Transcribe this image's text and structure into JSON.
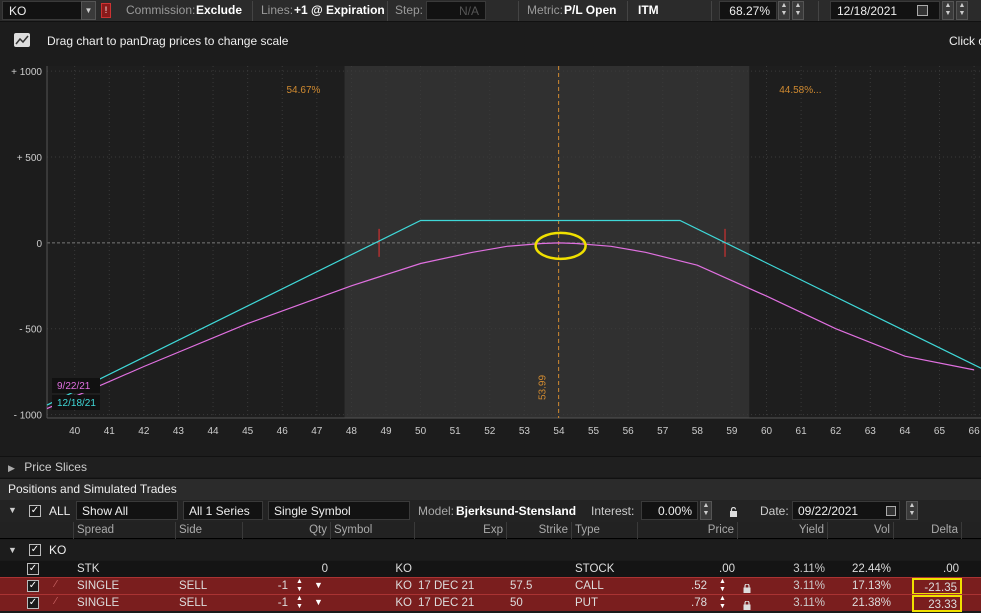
{
  "toolbar": {
    "symbol": "KO",
    "commission_label": "Commission:",
    "commission_value": "Exclude",
    "lines_label": "Lines:",
    "lines_value": "+1 @ Expiration",
    "step_label": "Step:",
    "step_value": "N/A",
    "metric_label": "Metric:",
    "metric_value": "P/L Open",
    "itm_label": "ITM",
    "itm_value": "68.27%",
    "date_value": "12/18/2021"
  },
  "hint": {
    "drag_text": "Drag chart to panDrag prices to change scale",
    "right_text": "Click o"
  },
  "chart_data": {
    "type": "line",
    "x_ticks": [
      40,
      41,
      42,
      43,
      44,
      45,
      46,
      47,
      48,
      49,
      50,
      51,
      52,
      53,
      54,
      55,
      56,
      57,
      58,
      59,
      60,
      61,
      62,
      63,
      64,
      65,
      66
    ],
    "x_tick_labels": [
      "40",
      "41",
      "42",
      "43",
      "44",
      "45",
      "46",
      "47",
      "48",
      "49",
      "50",
      "51",
      "52",
      "53",
      "54",
      "55",
      "56",
      "57",
      "58",
      "59",
      "60",
      "61",
      "62",
      "63",
      "64",
      "65",
      "66"
    ],
    "y_ticks": [
      1000,
      500,
      0,
      -500,
      -1000
    ],
    "y_tick_labels": [
      "+ 1000",
      "+ 500",
      "0",
      "- 500",
      "- 1000"
    ],
    "xlim": [
      39.2,
      66.2
    ],
    "ylim": [
      -1020,
      1030
    ],
    "itm_region": [
      47.8,
      59.5
    ],
    "pct_left": "54.67%",
    "pct_right": "44.58%...",
    "current_price": 53.99,
    "current_price_label": "53.99",
    "breakevens": [
      48.8,
      58.8
    ],
    "series": [
      {
        "name": "12/18/21",
        "color": "#3fd8d8",
        "x": [
          39.2,
          50.0,
          57.5,
          66.2
        ],
        "y": [
          -945,
          130,
          130,
          -730
        ]
      },
      {
        "name": "9/22/21",
        "color": "#e070e0",
        "x": [
          39.2,
          42.0,
          45.0,
          48.0,
          50.0,
          51.5,
          52.5,
          53.5,
          54.0,
          54.5,
          55.5,
          56.5,
          58.0,
          60.0,
          62.0,
          64.0,
          66.0
        ],
        "y": [
          -965,
          -720,
          -470,
          -250,
          -120,
          -55,
          -20,
          -4,
          0,
          -4,
          -20,
          -55,
          -130,
          -310,
          -500,
          -660,
          -740
        ]
      }
    ]
  },
  "price_slices": {
    "label": "Price Slices"
  },
  "positions": {
    "title": "Positions and Simulated Trades",
    "filter_all": "ALL",
    "show": "Show All",
    "series": "All 1 Series",
    "symbol_mode": "Single Symbol",
    "model_label": "Model:",
    "model_value": "Bjerksund-Stensland",
    "interest_label": "Interest:",
    "interest_value": "0.00%",
    "date_label": "Date:",
    "date_value": "09/22/2021",
    "columns": [
      "Spread",
      "Side",
      "Qty",
      "Symbol",
      "Exp",
      "Strike",
      "Type",
      "Price",
      "Yield",
      "Vol",
      "Delta"
    ],
    "group": "KO",
    "rows": [
      {
        "spread": "STK",
        "side": "",
        "qty": "0",
        "symbol": "KO",
        "exp": "",
        "strike": "",
        "type": "STOCK",
        "price": ".00",
        "yield": "3.11%",
        "vol": "22.44%",
        "delta": ".00"
      },
      {
        "spread": "SINGLE",
        "side": "SELL",
        "qty": "-1",
        "symbol": "KO",
        "exp": "17 DEC 21",
        "strike": "57.5",
        "type": "CALL",
        "price": ".52",
        "yield": "3.11%",
        "vol": "17.13%",
        "delta": "-21.35"
      },
      {
        "spread": "SINGLE",
        "side": "SELL",
        "qty": "-1",
        "symbol": "KO",
        "exp": "17 DEC 21",
        "strike": "50",
        "type": "PUT",
        "price": ".78",
        "yield": "3.11%",
        "vol": "21.38%",
        "delta": "23.33"
      }
    ]
  },
  "colors": {
    "accent_orange": "#d08a30",
    "cyan": "#3fd8d8",
    "magenta": "#e070e0",
    "highlight": "#f0e000",
    "position_row": "#7a1e1e"
  }
}
